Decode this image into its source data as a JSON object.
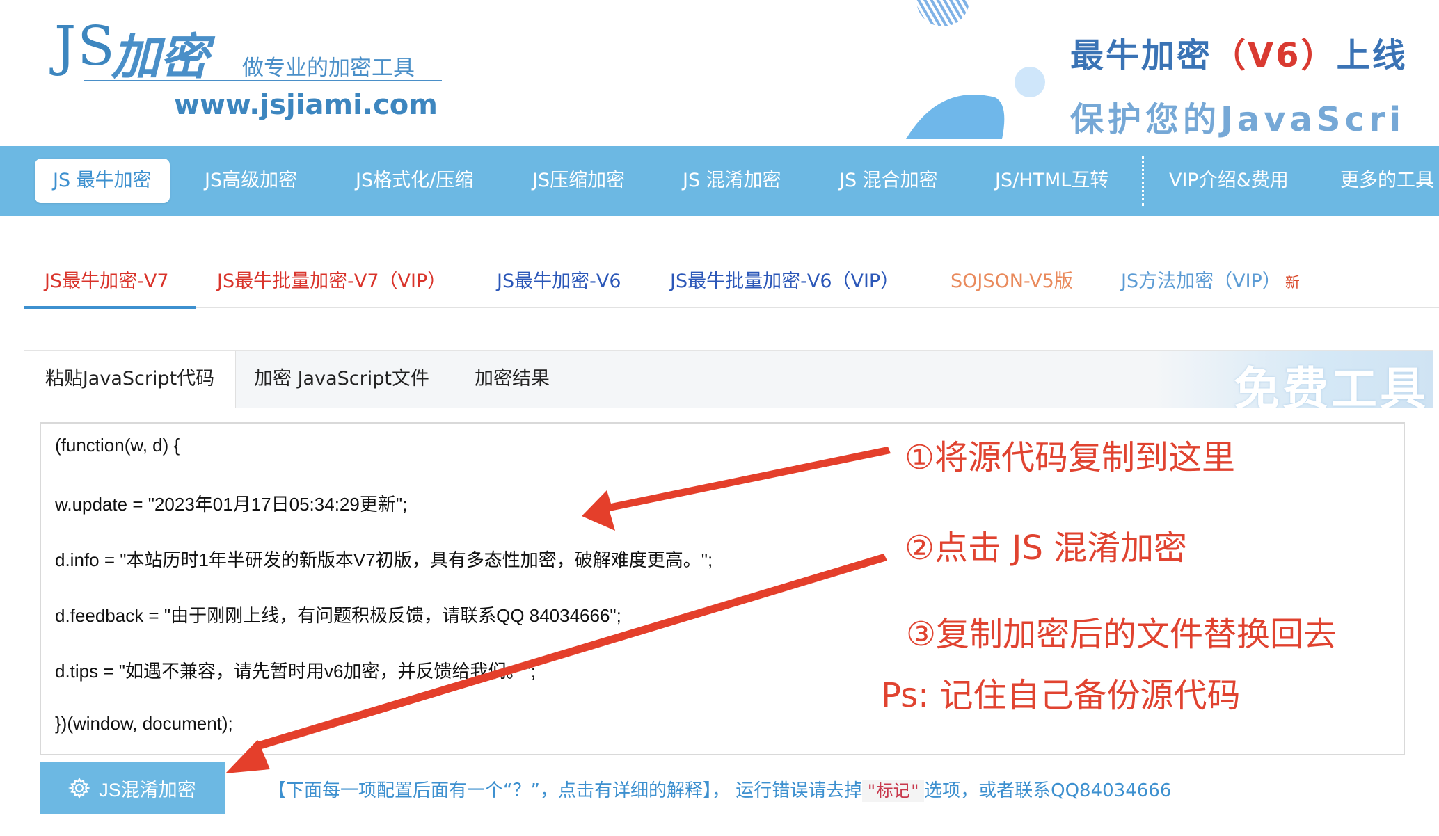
{
  "header": {
    "logo_js": "JS",
    "logo_jiami": "加密",
    "slogan": "做专业的加密工具",
    "url": "www.jsjiami.com",
    "banner_line1_prefix": "最牛加密",
    "banner_line1_version": "（V6）",
    "banner_line1_suffix": "上线",
    "banner_line2": "保护您的JavaScri"
  },
  "nav": {
    "items": [
      {
        "label": "JS 最牛加密"
      },
      {
        "label": "JS高级加密"
      },
      {
        "label": "JS格式化/压缩"
      },
      {
        "label": "JS压缩加密"
      },
      {
        "label": "JS 混淆加密"
      },
      {
        "label": "JS 混合加密"
      },
      {
        "label": "JS/HTML互转"
      },
      {
        "label": "VIP介绍&费用"
      },
      {
        "label": "更多的工具"
      }
    ]
  },
  "version_tabs": [
    {
      "label": "JS最牛加密-V7"
    },
    {
      "label": "JS最牛批量加密-V7（VIP）"
    },
    {
      "label": "JS最牛加密-V6"
    },
    {
      "label": "JS最牛批量加密-V6（VIP）"
    },
    {
      "label": "SOJSON-V5版"
    },
    {
      "label": "JS方法加密（VIP）"
    }
  ],
  "version_tab_new_badge": "新",
  "panel": {
    "tabs": [
      {
        "label": "粘贴JavaScript代码"
      },
      {
        "label": "加密 JavaScript文件"
      },
      {
        "label": "加密结果"
      }
    ],
    "watermark": "免费工具",
    "code_lines": [
      "(function(w, d) {",
      " w.update = \"2023年01月17日05:34:29更新\";",
      " d.info = \"本站历时1年半研发的新版本V7初版，具有多态性加密，破解难度更高。\";",
      " d.feedback = \"由于刚刚上线，有问题积极反馈，请联系QQ 84034666\";",
      " d.tips = \"如遇不兼容，请先暂时用v6加密，并反馈给我们。\";",
      "})(window, document);"
    ],
    "encrypt_button": "JS混淆加密",
    "hint_before": "【下面每一项配置后面有一个“？”，点击有详细的解释】， 运行错误请去掉",
    "hint_mark": "\"标记\"",
    "hint_after": "选项，或者联系QQ84034666"
  },
  "annotations": {
    "step1": "①将源代码复制到这里",
    "step2": "②点击 JS 混淆加密",
    "step3": "③复制加密后的文件替换回去",
    "ps": "Ps: 记住自己备份源代码"
  },
  "colors": {
    "nav_bg": "#6cb8e3",
    "accent_blue": "#3d90cf",
    "annotation_red": "#e04330",
    "v7_red": "#d9342b",
    "v5_orange": "#e98a5c"
  }
}
